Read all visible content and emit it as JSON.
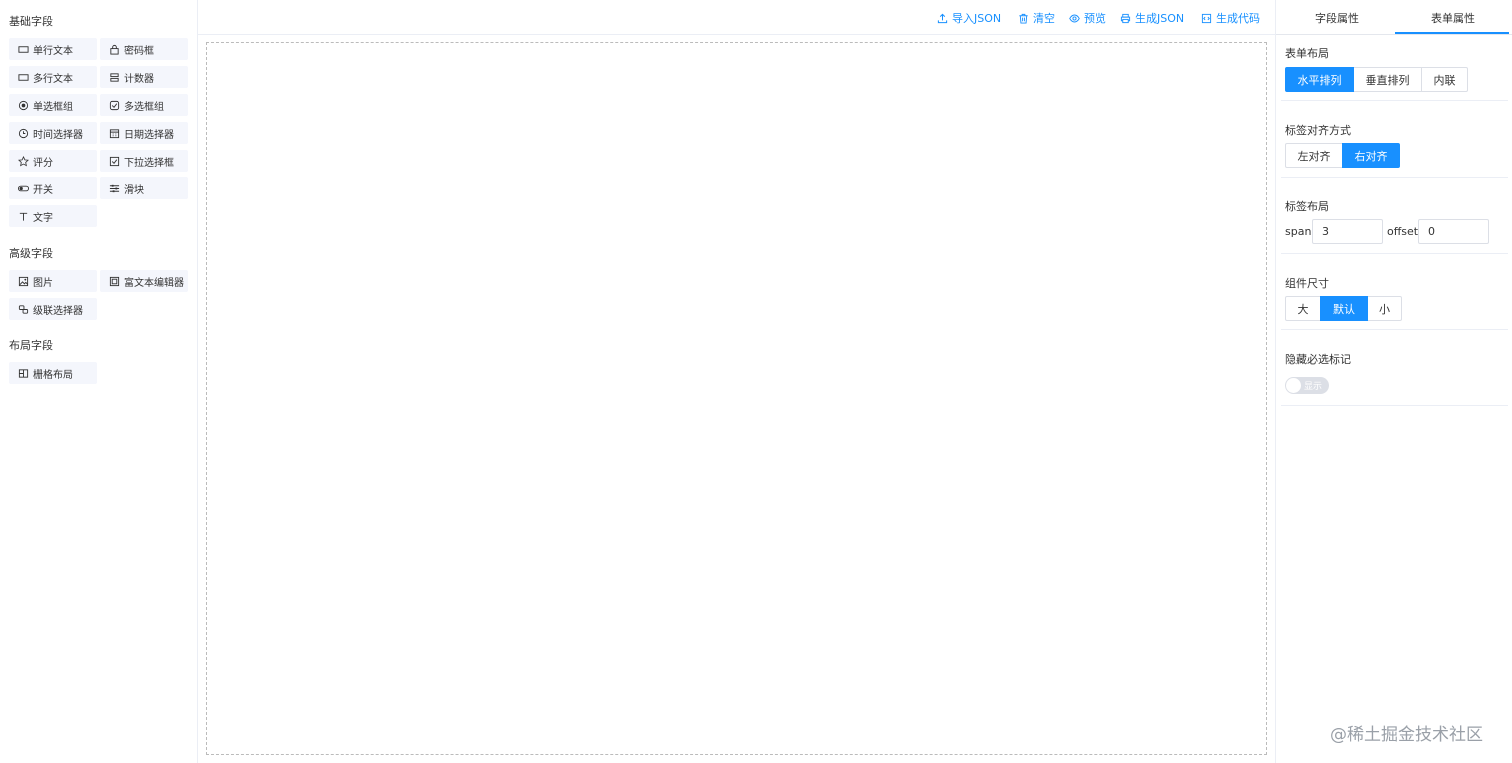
{
  "left": {
    "basic_title": "基础字段",
    "advanced_title": "高级字段",
    "layout_title": "布局字段",
    "basic_items": [
      {
        "label": "单行文本",
        "icon": "input-icon"
      },
      {
        "label": "密码框",
        "icon": "lock-icon"
      },
      {
        "label": "多行文本",
        "icon": "textarea-icon"
      },
      {
        "label": "计数器",
        "icon": "counter-icon"
      },
      {
        "label": "单选框组",
        "icon": "radio-icon"
      },
      {
        "label": "多选框组",
        "icon": "checkbox-icon"
      },
      {
        "label": "时间选择器",
        "icon": "clock-icon"
      },
      {
        "label": "日期选择器",
        "icon": "calendar-icon"
      },
      {
        "label": "评分",
        "icon": "star-icon"
      },
      {
        "label": "下拉选择框",
        "icon": "select-icon"
      },
      {
        "label": "开关",
        "icon": "switch-icon"
      },
      {
        "label": "滑块",
        "icon": "slider-icon"
      },
      {
        "label": "文字",
        "icon": "text-icon"
      }
    ],
    "advanced_items": [
      {
        "label": "图片",
        "icon": "image-icon"
      },
      {
        "label": "富文本编辑器",
        "icon": "editor-icon"
      },
      {
        "label": "级联选择器",
        "icon": "cascader-icon"
      }
    ],
    "layout_items": [
      {
        "label": "栅格布局",
        "icon": "grid-icon"
      }
    ]
  },
  "toolbar": {
    "import_json": "导入JSON",
    "clear": "清空",
    "preview": "预览",
    "gen_json": "生成JSON",
    "gen_code": "生成代码"
  },
  "right": {
    "tabs": [
      "字段属性",
      "表单属性"
    ],
    "active_tab": "表单属性",
    "form_layout": {
      "label": "表单布局",
      "options": [
        "水平排列",
        "垂直排列",
        "内联"
      ],
      "selected": "水平排列"
    },
    "label_align": {
      "label": "标签对齐方式",
      "options": [
        "左对齐",
        "右对齐"
      ],
      "selected": "右对齐"
    },
    "label_layout": {
      "label": "标签布局",
      "span_label": "span",
      "span_value": "3",
      "offset_label": "offset",
      "offset_value": "0"
    },
    "size": {
      "label": "组件尺寸",
      "options": [
        "大",
        "默认",
        "小"
      ],
      "selected": "默认"
    },
    "hide_required": {
      "label": "隐藏必选标记",
      "switch_text": "显示",
      "on": false
    }
  },
  "watermark": "@稀土掘金技术社区",
  "colors": {
    "accent": "#1890ff",
    "border": "#dcdfe6",
    "item_bg": "#f4f6fc"
  }
}
